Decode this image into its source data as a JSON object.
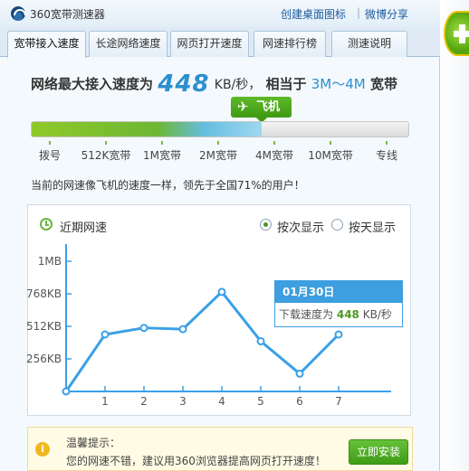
{
  "window": {
    "title": "360宽带测速器",
    "create_shortcut": "创建桌面图标",
    "separator": "|",
    "weibo_share": "微博分享"
  },
  "tabs": [
    {
      "label": "宽带接入速度",
      "active": true
    },
    {
      "label": "长途网络速度",
      "active": false
    },
    {
      "label": "网页打开速度",
      "active": false
    },
    {
      "label": "网速排行榜",
      "active": false
    },
    {
      "label": "测速说明",
      "active": false
    }
  ],
  "headline": {
    "prefix": "网络最大接入速度为",
    "speed": "448",
    "unit": "KB/秒，",
    "middle": "相当于",
    "bandwidth": "3M～4M",
    "suffix": "宽带"
  },
  "speed_marker": {
    "icon": "airplane-icon",
    "label": "飞机"
  },
  "speed_bar": {
    "level": 0.61,
    "ticks": [
      "拨号",
      "512K宽带",
      "1M宽带",
      "2M宽带",
      "4M宽带",
      "10M宽带",
      "专线"
    ]
  },
  "compare_text": "当前的网速像飞机的速度一样，领先于全国71%的用户！",
  "chart_panel": {
    "title": "近期网速",
    "title_icon": "clock-icon",
    "radio_by_count": "按次显示",
    "radio_by_day": "按天显示",
    "selected": "by_count"
  },
  "chart_data": {
    "type": "line",
    "title": "近期网速",
    "x": [
      0,
      1,
      2,
      3,
      4,
      5,
      6,
      7
    ],
    "x_tick_labels": [
      "1",
      "2",
      "3",
      "4",
      "5",
      "6",
      "7"
    ],
    "series": [
      {
        "values": [
          0,
          448,
          500,
          490,
          783,
          395,
          140,
          448
        ]
      }
    ],
    "y_tick_labels": [
      "1MB",
      "768KB",
      "512KB",
      "256KB"
    ],
    "y_ticks": [
      1024,
      768,
      512,
      256
    ],
    "ylim": [
      0,
      1024
    ],
    "xlim": [
      0,
      8
    ],
    "color": "#3ba0e6",
    "grid": false
  },
  "tooltip": {
    "date": "01月30日",
    "label": "下载速度为",
    "value": "448",
    "unit": "KB/秒"
  },
  "tip": {
    "title": "温馨提示：",
    "text": "您的网速不错，建议用360浏览器提高网页打开速度！",
    "button": "立即安装"
  },
  "colors": {
    "accent_blue": "#2c8fd0",
    "accent_green": "#4a9a20",
    "tooltip_blue": "#3d9ee0"
  }
}
